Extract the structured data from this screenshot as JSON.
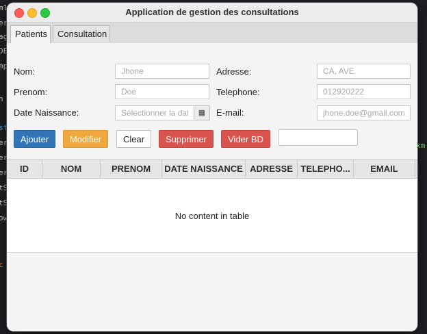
{
  "window": {
    "title": "Application de gestion des consultations"
  },
  "tabs": [
    {
      "label": "Patients",
      "active": true
    },
    {
      "label": "Consultation",
      "active": false
    }
  ],
  "form": {
    "nom": {
      "label": "Nom:",
      "placeholder": "Jhone"
    },
    "prenom": {
      "label": "Prenom:",
      "placeholder": "Doe"
    },
    "date_naissance": {
      "label": "Date Naissance:",
      "placeholder": "Sélectionner la date"
    },
    "adresse": {
      "label": "Adresse:",
      "placeholder": "CA, AVE"
    },
    "telephone": {
      "label": "Telephone:",
      "placeholder": "012920222"
    },
    "email": {
      "label": "E-mail:",
      "placeholder": "jhone.doe@gmail.com"
    },
    "calendar_icon": "calendar-icon"
  },
  "buttons": {
    "ajouter": "Ajouter",
    "modifier": "Modifier",
    "clear": "Clear",
    "supprimer": "Supprimer",
    "vider": "Vider BD"
  },
  "search": {
    "value": ""
  },
  "table": {
    "columns": [
      "ID",
      "NOM",
      "PRENOM",
      "DATE NAISSANCE",
      "ADRESSE",
      "TELEPHO...",
      "EMAIL"
    ],
    "empty_text": "No content in table"
  },
  "colors": {
    "ajouter": "#3275b6",
    "modifier": "#efa740",
    "supprimer": "#d9534f",
    "vider": "#d9534f"
  }
}
